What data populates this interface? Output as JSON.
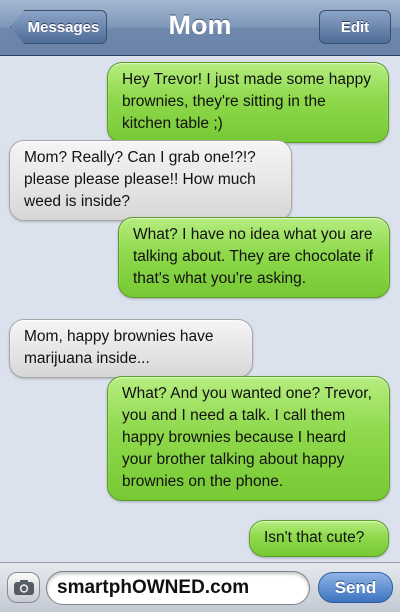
{
  "header": {
    "back_label": "Messages",
    "title": "Mom",
    "edit_label": "Edit"
  },
  "messages": [
    {
      "from": "me",
      "text": "Hey Trevor! I just made some happy brownies, they're sitting in the kitchen table ;)"
    },
    {
      "from": "mom",
      "text": "Mom? Really? Can I grab one!?!? please please please!! How much weed is inside?"
    },
    {
      "from": "me",
      "text": "What? I have no idea what you are talking about. They are chocolate if that's what you're asking."
    },
    {
      "from": "mom",
      "text": "Mom, happy brownies have marijuana inside..."
    },
    {
      "from": "me",
      "text": "What? And you wanted one? Trevor, you and I need a talk. I call them happy brownies because I heard your brother talking about happy brownies on the phone."
    },
    {
      "from": "me",
      "text": "Isn't that cute?"
    }
  ],
  "composer": {
    "input_value": "smartphOWNED.com",
    "send_label": "Send",
    "camera_icon": "camera-icon"
  },
  "colors": {
    "sent_bubble": "#8ed94c",
    "received_bubble": "#e4e4e4",
    "background": "#dbe2ed",
    "navbar": "#7f97b9"
  }
}
